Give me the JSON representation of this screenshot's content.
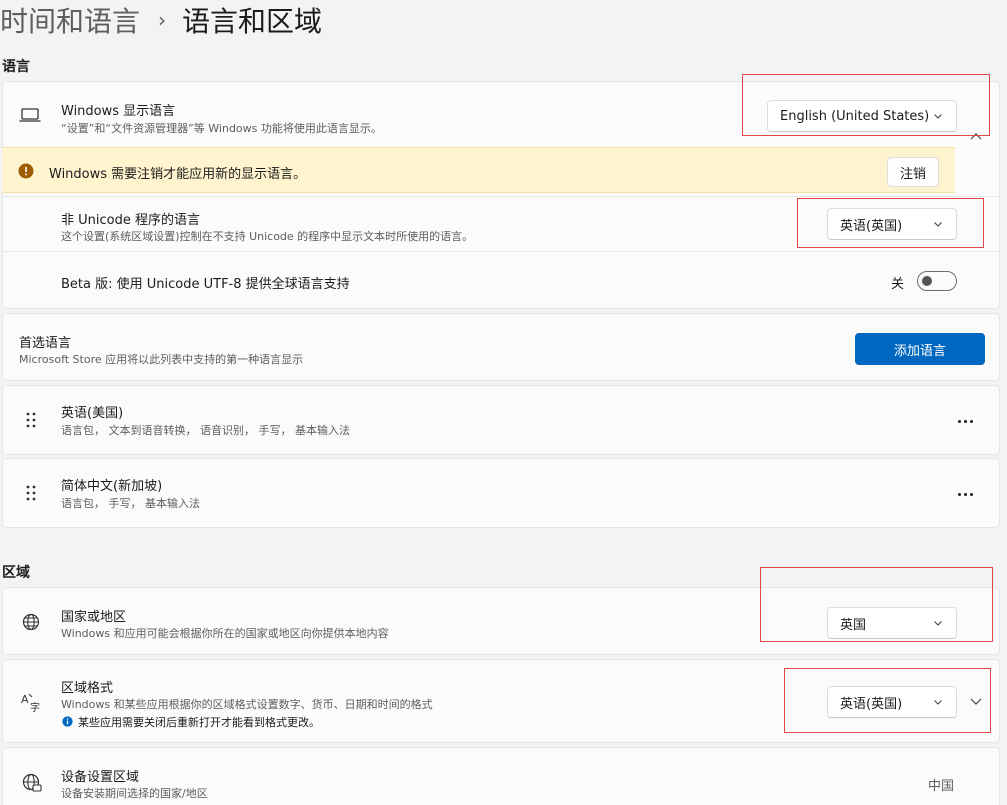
{
  "breadcrumb": {
    "parent": "时间和语言",
    "separator": "›",
    "current": "语言和区域"
  },
  "language_section": {
    "title": "语言",
    "display_language": {
      "icon": "laptop-icon",
      "title": "Windows 显示语言",
      "subtitle": "“设置”和“文件资源管理器”等 Windows 功能将使用此语言显示。",
      "value": "English (United States)"
    },
    "warning": {
      "icon": "warning-icon",
      "text": "Windows 需要注销才能应用新的显示语言。",
      "button": "注销"
    },
    "non_unicode": {
      "title": "非 Unicode 程序的语言",
      "subtitle": "这个设置(系统区域设置)控制在不支持 Unicode 的程序中显示文本时所使用的语言。",
      "value": "英语(英国)"
    },
    "beta_utf8": {
      "title": "Beta 版: 使用 Unicode UTF-8 提供全球语言支持",
      "state_label": "关"
    }
  },
  "preferred_languages": {
    "title": "首选语言",
    "subtitle": "Microsoft Store 应用将以此列表中支持的第一种语言显示",
    "add_button": "添加语言",
    "items": [
      {
        "name": "英语(美国)",
        "features": "语言包， 文本到语音转换， 语音识别， 手写， 基本输入法"
      },
      {
        "name": "简体中文(新加坡)",
        "features": "语言包， 手写， 基本输入法"
      }
    ]
  },
  "region_section": {
    "title": "区域",
    "country": {
      "icon": "globe-icon",
      "title": "国家或地区",
      "subtitle": "Windows 和应用可能会根据你所在的国家或地区向你提供本地内容",
      "value": "英国"
    },
    "regional_format": {
      "icon": "regional-format-icon",
      "title": "区域格式",
      "subtitle": "Windows 和某些应用根据你的区域格式设置数字、货币、日期和时间的格式",
      "info": "某些应用需要关闭后重新打开才能看到格式更改。",
      "value": "英语(英国)"
    },
    "device_region": {
      "icon": "device-globe-icon",
      "title": "设备设置区域",
      "subtitle": "设备安装期间选择的国家/地区",
      "value": "中国"
    }
  },
  "colors": {
    "accent": "#0067c0",
    "warning_bg": "#fff4ce",
    "annotation": "#e0454a"
  }
}
